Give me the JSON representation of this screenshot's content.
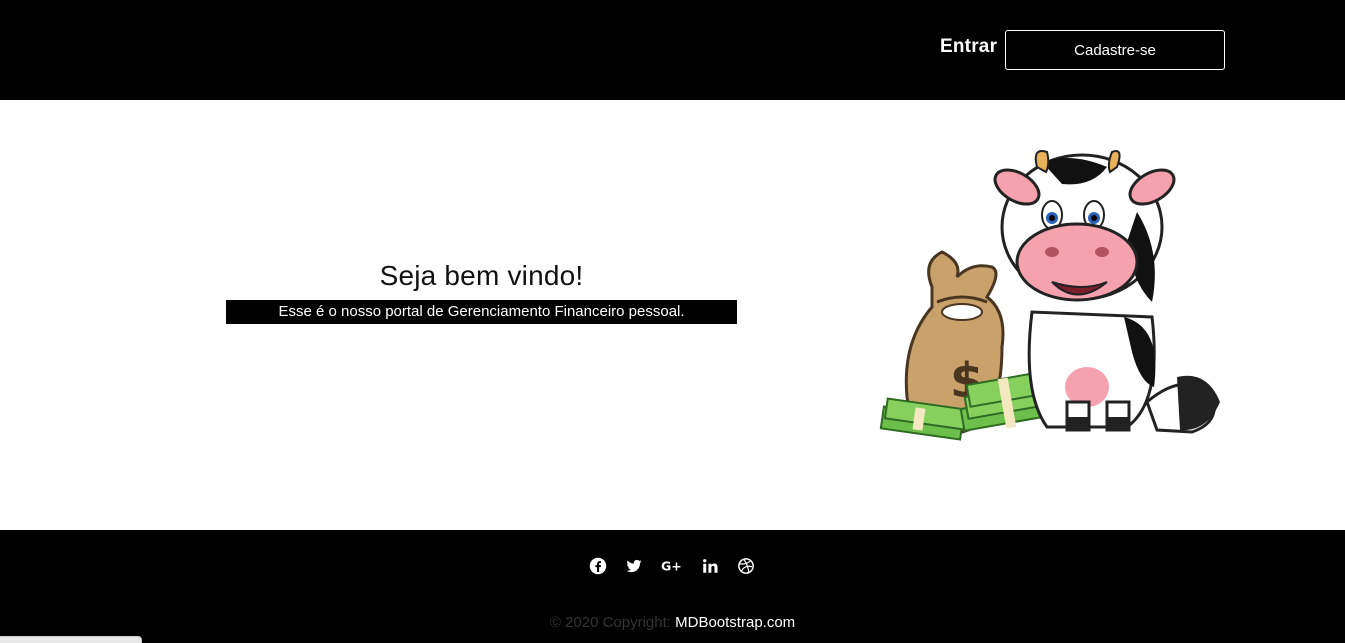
{
  "header": {
    "login_label": "Entrar",
    "signup_label": "Cadastre-se"
  },
  "hero": {
    "title": "Seja bem vindo!",
    "subtitle": "Esse é o nosso portal de Gerenciamento Financeiro pessoal."
  },
  "footer": {
    "social_icons": [
      "facebook-icon",
      "twitter-icon",
      "google-plus-icon",
      "linkedin-icon",
      "dribbble-icon"
    ],
    "copyright_text": "© 2020 Copyright:",
    "copyright_link": "MDBootstrap.com"
  },
  "colors": {
    "header_bg": "#000000",
    "footer_bg": "#000000",
    "text_light": "#ffffff"
  }
}
